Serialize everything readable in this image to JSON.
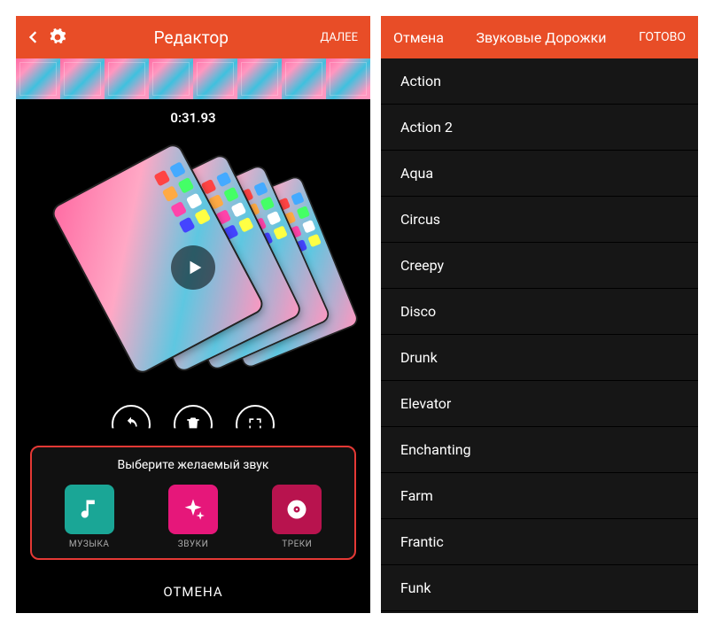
{
  "left": {
    "header": {
      "title": "Редактор",
      "next": "ДАЛЕЕ"
    },
    "timecode": "0:31.93",
    "toolbar": {},
    "soundPanel": {
      "title": "Выберите желаемый звук",
      "options": [
        {
          "label": "МУЗЫКА",
          "color": "#1aa696",
          "icon": "music"
        },
        {
          "label": "ЗВУКИ",
          "color": "#e6177a",
          "icon": "spark"
        },
        {
          "label": "ТРЕКИ",
          "color": "#b8134e",
          "icon": "disc"
        }
      ]
    },
    "cancel": "ОТМЕНА"
  },
  "right": {
    "header": {
      "cancel": "Отмена",
      "title": "Звуковые Дорожки",
      "done": "ГОТОВО"
    },
    "tracks": [
      "Action",
      "Action 2",
      "Aqua",
      "Circus",
      "Creepy",
      "Disco",
      "Drunk",
      "Elevator",
      "Enchanting",
      "Farm",
      "Frantic",
      "Funk"
    ]
  }
}
